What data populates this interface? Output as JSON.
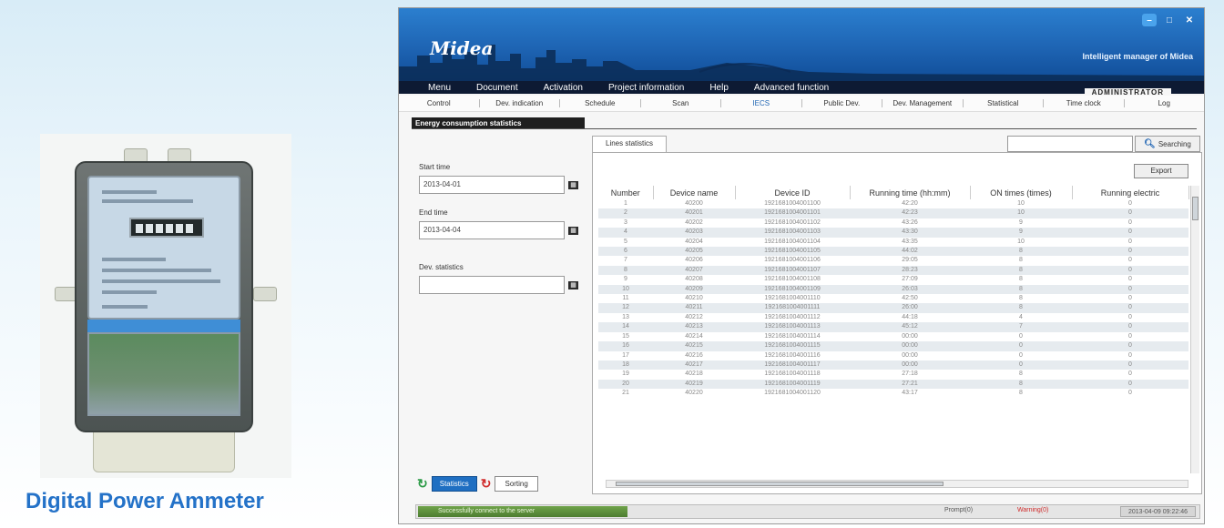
{
  "caption": "Digital Power Ammeter",
  "app": {
    "logo": "Midea",
    "tagline": "Intelligent manager of Midea",
    "window_controls": {
      "minimize": "–",
      "maximize": "□",
      "close": "✕"
    },
    "menu": [
      "Menu",
      "Document",
      "Activation",
      "Project information",
      "Help",
      "Advanced function"
    ],
    "user_label": "ADMINISTRATOR",
    "toolbar": [
      "Control",
      "Dev. indication",
      "Schedule",
      "Scan",
      "IECS",
      "Public Dev.",
      "Dev. Management",
      "Statistical",
      "Time clock",
      "Log"
    ],
    "toolbar_active": "IECS",
    "section_title": "Energy consumption statistics",
    "form": {
      "start_label": "Start time",
      "start_value": "2013-04-01",
      "end_label": "End time",
      "end_value": "2013-04-04",
      "dev_label": "Dev. statistics",
      "dev_value": ""
    },
    "buttons": {
      "statistics": "Statistics",
      "sorting": "Sorting"
    },
    "tab": "Lines statistics",
    "search_button": "Searching",
    "export_button": "Export",
    "table": {
      "headers": [
        "Number",
        "Device name",
        "Device ID",
        "Running time (hh:mm)",
        "ON times (times)",
        "Running electric"
      ],
      "rows": [
        [
          "1",
          "40200",
          "1921681004001100",
          "42:20",
          "10",
          "0"
        ],
        [
          "2",
          "40201",
          "1921681004001101",
          "42:23",
          "10",
          "0"
        ],
        [
          "3",
          "40202",
          "1921681004001102",
          "43:26",
          "9",
          "0"
        ],
        [
          "4",
          "40203",
          "1921681004001103",
          "43:30",
          "9",
          "0"
        ],
        [
          "5",
          "40204",
          "1921681004001104",
          "43:35",
          "10",
          "0"
        ],
        [
          "6",
          "40205",
          "1921681004001105",
          "44:02",
          "8",
          "0"
        ],
        [
          "7",
          "40206",
          "1921681004001106",
          "29:05",
          "8",
          "0"
        ],
        [
          "8",
          "40207",
          "1921681004001107",
          "28:23",
          "8",
          "0"
        ],
        [
          "9",
          "40208",
          "1921681004001108",
          "27:09",
          "8",
          "0"
        ],
        [
          "10",
          "40209",
          "1921681004001109",
          "26:03",
          "8",
          "0"
        ],
        [
          "11",
          "40210",
          "1921681004001110",
          "42:50",
          "8",
          "0"
        ],
        [
          "12",
          "40211",
          "1921681004001111",
          "26:00",
          "8",
          "0"
        ],
        [
          "13",
          "40212",
          "1921681004001112",
          "44:18",
          "4",
          "0"
        ],
        [
          "14",
          "40213",
          "1921681004001113",
          "45:12",
          "7",
          "0"
        ],
        [
          "15",
          "40214",
          "1921681004001114",
          "00:00",
          "0",
          "0"
        ],
        [
          "16",
          "40215",
          "1921681004001115",
          "00:00",
          "0",
          "0"
        ],
        [
          "17",
          "40216",
          "1921681004001116",
          "00:00",
          "0",
          "0"
        ],
        [
          "18",
          "40217",
          "1921681004001117",
          "00:00",
          "0",
          "0"
        ],
        [
          "19",
          "40218",
          "1921681004001118",
          "27:18",
          "8",
          "0"
        ],
        [
          "20",
          "40219",
          "1921681004001119",
          "27:21",
          "8",
          "0"
        ],
        [
          "21",
          "40220",
          "1921681004001120",
          "43:17",
          "8",
          "0"
        ]
      ]
    },
    "status": {
      "message": "Successfully connect to the server",
      "item1": "Prompt(0)",
      "item2": "Warning(0)",
      "time": "2013-04-09 09:22:46"
    }
  }
}
